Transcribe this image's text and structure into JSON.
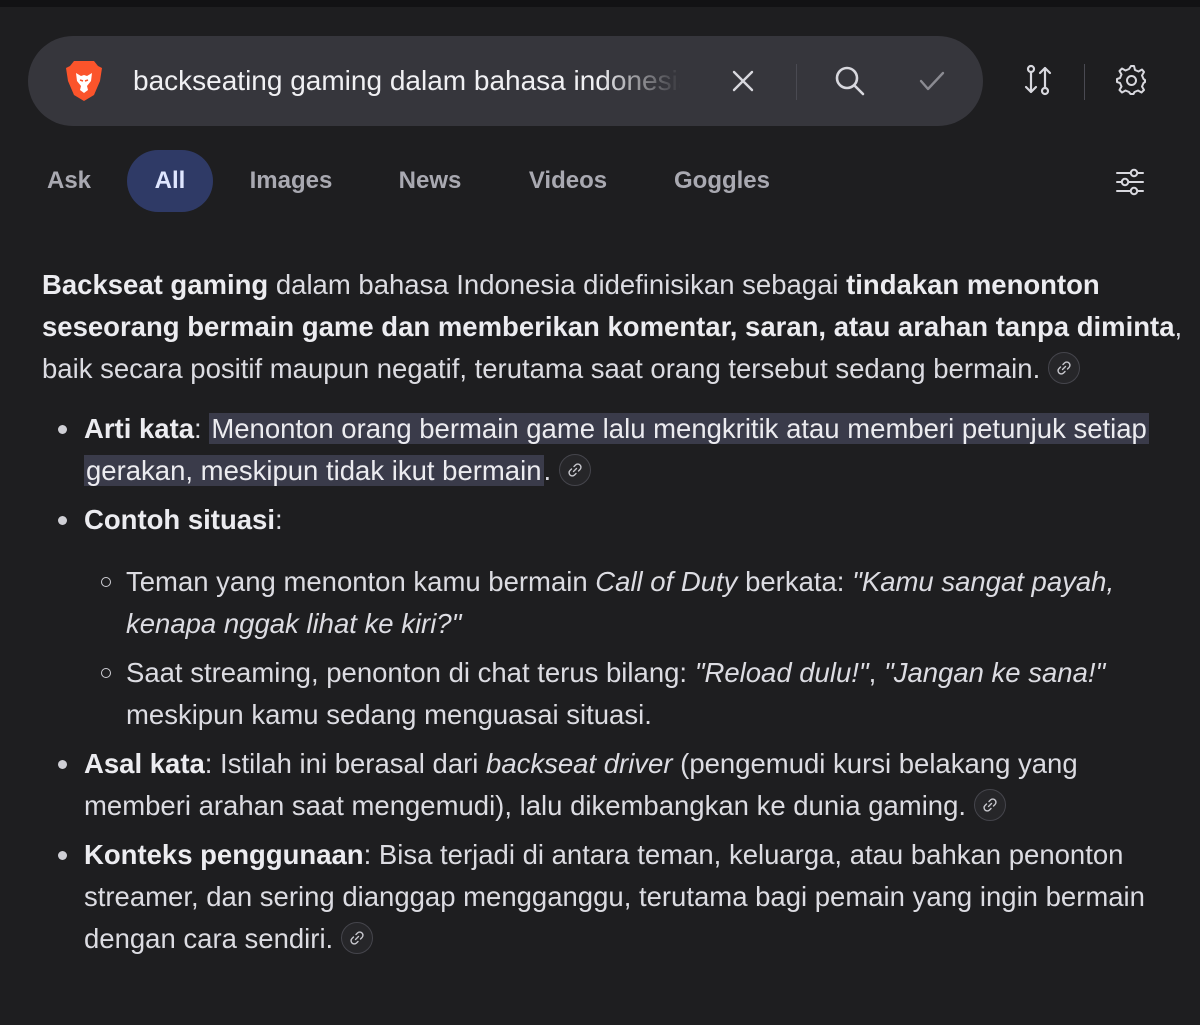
{
  "search": {
    "query": "backseating gaming dalam bahasa indonesia",
    "icons": [
      "brave-lion-logo",
      "close-icon",
      "search-icon",
      "checkmark-icon"
    ]
  },
  "toolbar": {
    "icons": [
      "sort-icon",
      "gear-icon"
    ]
  },
  "tabs": [
    {
      "label": "Ask"
    },
    {
      "label": "All",
      "active": true
    },
    {
      "label": "Images"
    },
    {
      "label": "News"
    },
    {
      "label": "Videos"
    },
    {
      "label": "Goggles"
    }
  ],
  "colors": {
    "active_tab_bg": "#2f3a66",
    "highlight_bg": "#3a3b4a",
    "page_bg": "#1e1e20"
  },
  "answer": {
    "intro": {
      "b1": "Backseat gaming",
      "t1": " dalam bahasa Indonesia didefinisikan sebagai ",
      "b2": "tindakan menonton seseorang bermain game dan memberikan komentar, saran, atau arahan tanpa diminta",
      "t2": ", baik secara positif maupun negatif, terutama saat orang tersebut sedang bermain."
    },
    "arti": {
      "label": "Arti kata",
      "colon": ": ",
      "text": "Menonton orang bermain game lalu mengkritik atau memberi petunjuk setiap gerakan, meskipun tidak ikut bermain",
      "end": "."
    },
    "contoh": {
      "label": "Contoh situasi",
      "colon": ":",
      "s1": {
        "t1": "Teman yang menonton kamu bermain ",
        "i1": "Call of Duty",
        "t2": " berkata: ",
        "i2": "\"Kamu sangat payah, kenapa nggak lihat ke kiri?\""
      },
      "s2": {
        "t1": "Saat streaming, penonton di chat terus bilang: ",
        "i1": "\"Reload dulu!\"",
        "t2": ", ",
        "i2": "\"Jangan ke sana!\"",
        "t3": " meskipun kamu sedang menguasai situasi."
      }
    },
    "asal": {
      "label": "Asal kata",
      "t1": ": Istilah ini berasal dari ",
      "i1": "backseat driver",
      "t2": " (pengemudi kursi belakang yang memberi arahan saat mengemudi), lalu dikembangkan ke dunia gaming."
    },
    "konteks": {
      "label": "Konteks penggunaan",
      "t1": ": Bisa terjadi di antara teman, keluarga, atau bahkan penonton streamer, dan sering dianggap mengganggu, terutama bagi pemain yang ingin bermain dengan cara sendiri."
    }
  }
}
